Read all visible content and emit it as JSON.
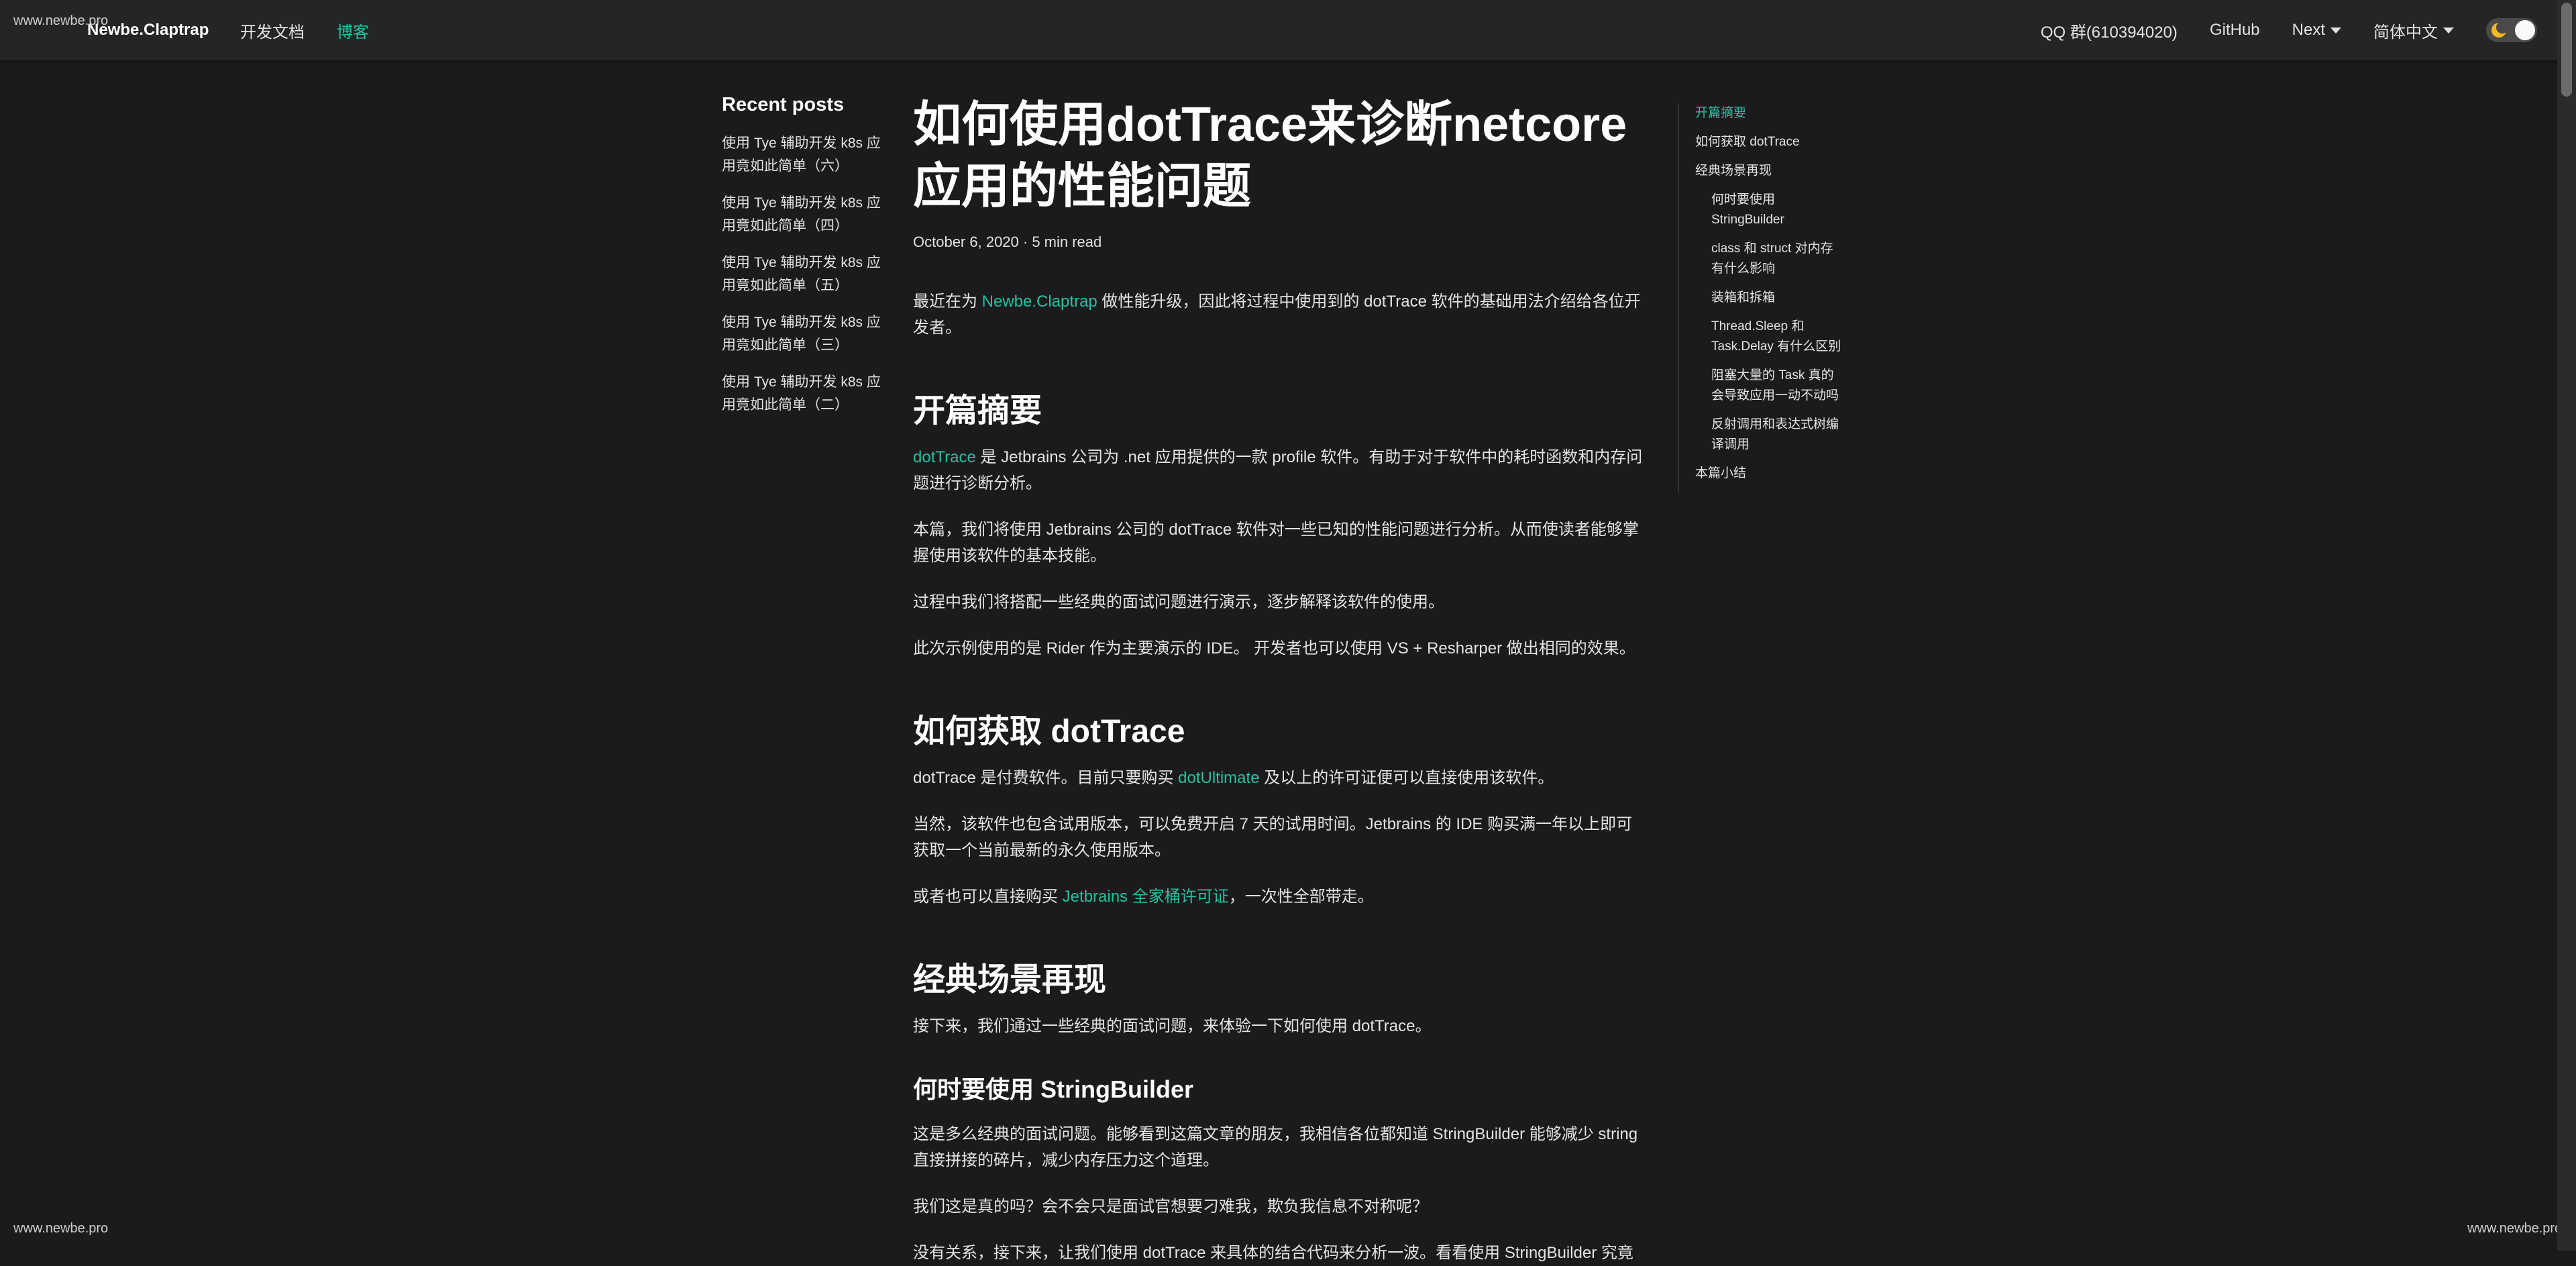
{
  "watermark": "www.newbe.pro",
  "navbar": {
    "brand": "Newbe.Claptrap",
    "links": [
      "开发文档",
      "博客"
    ],
    "right": {
      "qq": "QQ 群(610394020)",
      "github": "GitHub",
      "version": "Next",
      "locale": "简体中文"
    }
  },
  "sidebar": {
    "title": "Recent posts",
    "items": [
      "使用 Tye 辅助开发 k8s 应用竟如此简单（六）",
      "使用 Tye 辅助开发 k8s 应用竟如此简单（四）",
      "使用 Tye 辅助开发 k8s 应用竟如此简单（五）",
      "使用 Tye 辅助开发 k8s 应用竟如此简单（三）",
      "使用 Tye 辅助开发 k8s 应用竟如此简单（二）"
    ]
  },
  "article": {
    "title": "如何使用dotTrace来诊断netcore应用的性能问题",
    "meta": "October 6, 2020 · 5 min read",
    "intro": {
      "before": "最近在为 ",
      "link": "Newbe.Claptrap",
      "after": " 做性能升级，因此将过程中使用到的 dotTrace 软件的基础用法介绍给各位开发者。"
    },
    "h_summary": "开篇摘要",
    "summary_p1": {
      "link": "dotTrace",
      "after": " 是 Jetbrains 公司为 .net 应用提供的一款 profile 软件。有助于对于软件中的耗时函数和内存问题进行诊断分析。"
    },
    "summary_p2": "本篇，我们将使用 Jetbrains 公司的 dotTrace 软件对一些已知的性能问题进行分析。从而使读者能够掌握使用该软件的基本技能。",
    "summary_p3": "过程中我们将搭配一些经典的面试问题进行演示，逐步解释该软件的使用。",
    "summary_p4": "此次示例使用的是 Rider 作为主要演示的 IDE。 开发者也可以使用 VS + Resharper 做出相同的效果。",
    "h_get": "如何获取 dotTrace",
    "get_p1": {
      "before": "dotTrace 是付费软件。目前只要购买 ",
      "link": "dotUltimate",
      "after": " 及以上的许可证便可以直接使用该软件。"
    },
    "get_p2": "当然，该软件也包含试用版本，可以免费开启 7 天的试用时间。Jetbrains 的 IDE 购买满一年以上即可获取一个当前最新的永久使用版本。",
    "get_p3": {
      "before": "或者也可以直接购买 ",
      "link": "Jetbrains 全家桶许可证",
      "after": "，一次性全部带走。"
    },
    "h_scenes": "经典场景再现",
    "scenes_p1": "接下来，我们通过一些经典的面试问题，来体验一下如何使用 dotTrace。",
    "h_sb": "何时要使用 StringBuilder",
    "sb_p1": "这是多么经典的面试问题。能够看到这篇文章的朋友，我相信各位都知道 StringBuilder 能够减少 string 直接拼接的碎片，减少内存压力这个道理。",
    "sb_p2": "我们这是真的吗？会不会只是面试官想要刁难我，欺负我信息不对称呢？",
    "sb_p3": "没有关系，接下来，让我们使用 dotTrace 来具体的结合代码来分析一波。看看使用 StringBuilder 究竟"
  },
  "toc": [
    {
      "label": "开篇摘要",
      "level": 1,
      "active": true
    },
    {
      "label": "如何获取 dotTrace",
      "level": 1
    },
    {
      "label": "经典场景再现",
      "level": 1
    },
    {
      "label": "何时要使用 StringBuilder",
      "level": 2
    },
    {
      "label": "class 和 struct 对内存有什么影响",
      "level": 2
    },
    {
      "label": "装箱和拆箱",
      "level": 2
    },
    {
      "label": "Thread.Sleep 和 Task.Delay 有什么区别",
      "level": 2
    },
    {
      "label": "阻塞大量的 Task 真的会导致应用一动不动吗",
      "level": 2
    },
    {
      "label": "反射调用和表达式树编译调用",
      "level": 2
    },
    {
      "label": "本篇小结",
      "level": 1
    }
  ],
  "colors": {
    "background": "#1b1b1d",
    "navbar": "#242526",
    "accent": "#25c2a0"
  }
}
